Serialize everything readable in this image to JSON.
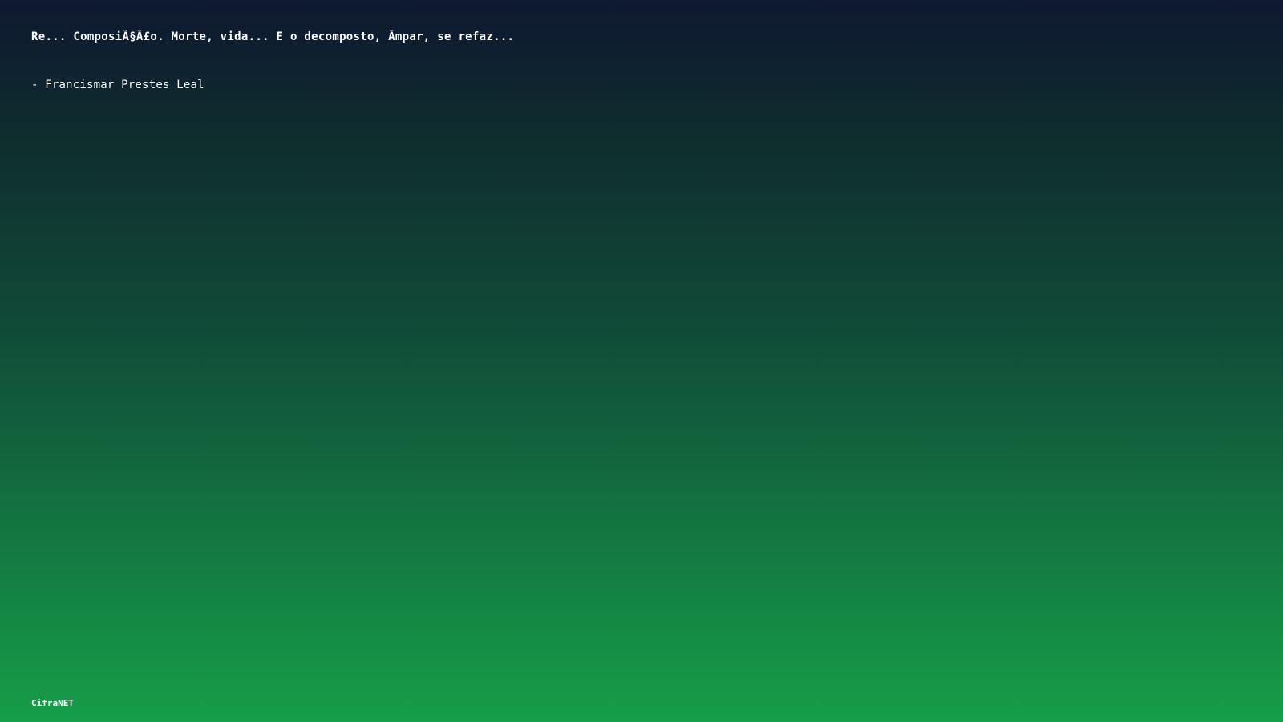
{
  "quote": {
    "text": "Re... ComposiÃ§Ã£o. Morte, vida... E o decomposto, Ã­mpar, se refaz...",
    "author": "- Francismar Prestes Leal"
  },
  "footer": {
    "brand": "CifraNET"
  },
  "colors": {
    "background_top": "#0e1830",
    "background_bottom": "#169e48",
    "text": "#ffffff"
  }
}
